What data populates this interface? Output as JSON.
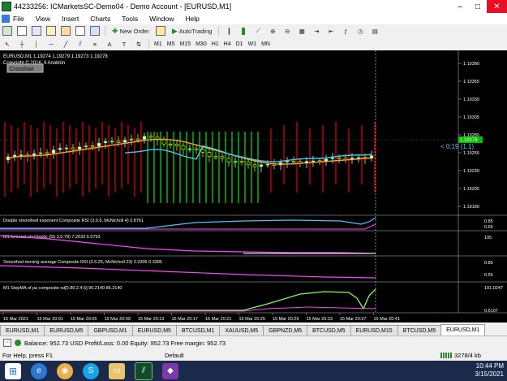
{
  "window": {
    "title": "44233256: ICMarketsSC-Demo04 - Demo Account - [EURUSD,M1]",
    "min": "–",
    "max": "□",
    "close": "✕"
  },
  "menu": [
    "File",
    "View",
    "Insert",
    "Charts",
    "Tools",
    "Window",
    "Help"
  ],
  "toolbar": {
    "new_order": "New Order",
    "autotrading": "AutoTrading"
  },
  "timeframes": [
    "M1",
    "M5",
    "M15",
    "M30",
    "H1",
    "H4",
    "D1",
    "W1",
    "MN"
  ],
  "chart": {
    "crosshair_label": "Crosshair",
    "symbol_line": "EURUSD,M1  1.19274 1.19279 1.19273 1.19278",
    "copyright": "Copyright © 2016, Il Anokhin",
    "timer": "< 0:19 (1.1)",
    "price_ticks": [
      "1.19380",
      "1.19355",
      "1.19330",
      "1.19305",
      "1.19280",
      "1.19255",
      "1.19230",
      "1.19205",
      "1.19180"
    ],
    "current_price": "1.19278",
    "ind1_label": "Double smoothed exponent Composite RSI (3.0.6, McNicholl 4) 0.8761",
    "ind1_ticks": [
      "0.85",
      "0.65"
    ],
    "ind2_label": "M1 forecast stochastic (55.3,5.78) 7.2033 6.5793",
    "ind2_ticks": [
      "105"
    ],
    "ind3_label": "Smoothed moving average Composite RSI (3.5.25, McNicholl 23) 0.3305 0.3305",
    "ind3_ticks": [
      "0.85",
      "0.55"
    ],
    "ind4_label": "M1 StepMA of pa composite rsi[0.80,2.4.5] 96.2140 86.2140",
    "ind4_ticks": [
      "101.0247",
      "0.6107"
    ],
    "time_labels": [
      "15 Mar 2021",
      "15 Mar 20:01",
      "15 Mar 20:05",
      "15 Mar 20:09",
      "15 Mar 20:13",
      "15 Mar 20:17",
      "15 Mar 20:21",
      "15 Mar 20:25",
      "15 Mar 20:29",
      "15 Mar 20:33",
      "15 Mar 20:37",
      "15 Mar 20:41"
    ]
  },
  "tabs": [
    "EURUSD,M1",
    "EURUSD,M5",
    "GBPUSD,M1",
    "EURUSD,M5",
    "BTCUSD,M1",
    "XAUUSD,M5",
    "GBPNZD,M5",
    "BTCUSD,M5",
    "EURUSD,M15",
    "BTCUSD,M5",
    "EURUSD,M1"
  ],
  "terminal": {
    "balance_line": "Balance: 952.73 USD  Profit/Loss: 0.00  Equity: 952.73  Free margin: 952.73"
  },
  "status": {
    "help": "For Help, press F1",
    "profile": "Default",
    "traffic": "3278/4 kb"
  },
  "clock": {
    "time": "10:44 PM",
    "date": "3/15/2021"
  },
  "colors": {
    "bull": "#00ff00",
    "bear": "#ff0000",
    "ma_orange": "#ffa040",
    "ma_blue": "#40c8ff",
    "pink": "#ff44ff",
    "light_green": "#7cff50"
  }
}
